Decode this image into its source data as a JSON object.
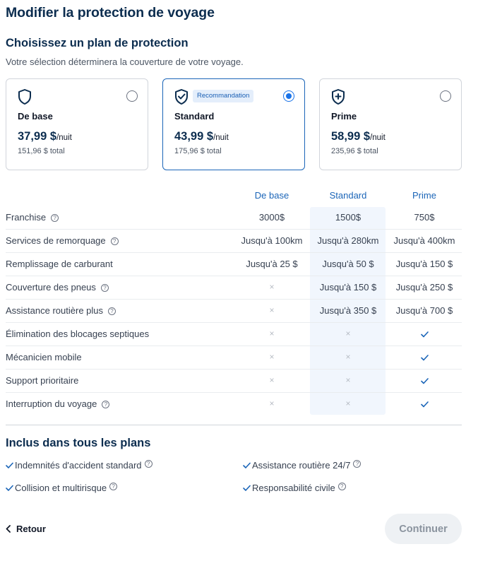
{
  "page": {
    "title": "Modifier la protection de voyage",
    "section_title": "Choisissez un plan de protection",
    "section_subtitle": "Votre sélection déterminera la couverture de votre voyage."
  },
  "plans": [
    {
      "name": "De base",
      "price": "37,99 $",
      "unit": "/nuit",
      "total": "151,96 $ total",
      "selected": false,
      "badge": ""
    },
    {
      "name": "Standard",
      "price": "43,99 $",
      "unit": "/nuit",
      "total": "175,96 $ total",
      "selected": true,
      "badge": "Recommandation"
    },
    {
      "name": "Prime",
      "price": "58,99 $",
      "unit": "/nuit",
      "total": "235,96 $ total",
      "selected": false,
      "badge": ""
    }
  ],
  "table": {
    "columns": [
      "De base",
      "Standard",
      "Prime"
    ],
    "rows": [
      {
        "label": "Franchise",
        "help": true,
        "values": [
          "3000$",
          "1500$",
          "750$"
        ]
      },
      {
        "label": "Services de remorquage",
        "help": true,
        "values": [
          "Jusqu'à 100km",
          "Jusqu'à 280km",
          "Jusqu'à 400km"
        ]
      },
      {
        "label": "Remplissage de carburant",
        "help": false,
        "values": [
          "Jusqu'à 25 $",
          "Jusqu'à 50 $",
          "Jusqu'à 150 $"
        ]
      },
      {
        "label": "Couverture des pneus",
        "help": true,
        "values": [
          "×",
          "Jusqu'à 150 $",
          "Jusqu'à 250 $"
        ]
      },
      {
        "label": "Assistance routière plus",
        "help": true,
        "values": [
          "×",
          "Jusqu'à 350 $",
          "Jusqu'à 700 $"
        ]
      },
      {
        "label": "Élimination des blocages septiques",
        "help": false,
        "values": [
          "×",
          "×",
          "check"
        ]
      },
      {
        "label": "Mécanicien mobile",
        "help": false,
        "values": [
          "×",
          "×",
          "check"
        ]
      },
      {
        "label": "Support prioritaire",
        "help": false,
        "values": [
          "×",
          "×",
          "check"
        ]
      },
      {
        "label": "Interruption du voyage",
        "help": true,
        "values": [
          "×",
          "×",
          "check"
        ]
      }
    ]
  },
  "included": {
    "title": "Inclus dans tous les plans",
    "items": [
      "Indemnités d'accident standard",
      "Assistance routière 24/7",
      "Collision et multirisque",
      "Responsabilité civile"
    ]
  },
  "footer": {
    "back_label": "Retour",
    "continue_label": "Continuer"
  },
  "colors": {
    "accent": "#1a73e8",
    "heading": "#0c2d4f",
    "check": "#1b65b8"
  },
  "icons": {
    "plan_base": "shield-icon",
    "plan_standard": "shield-check-icon",
    "plan_prime": "shield-plus-icon",
    "help": "help-circle-icon",
    "included": "check-icon",
    "back": "chevron-left-icon"
  }
}
